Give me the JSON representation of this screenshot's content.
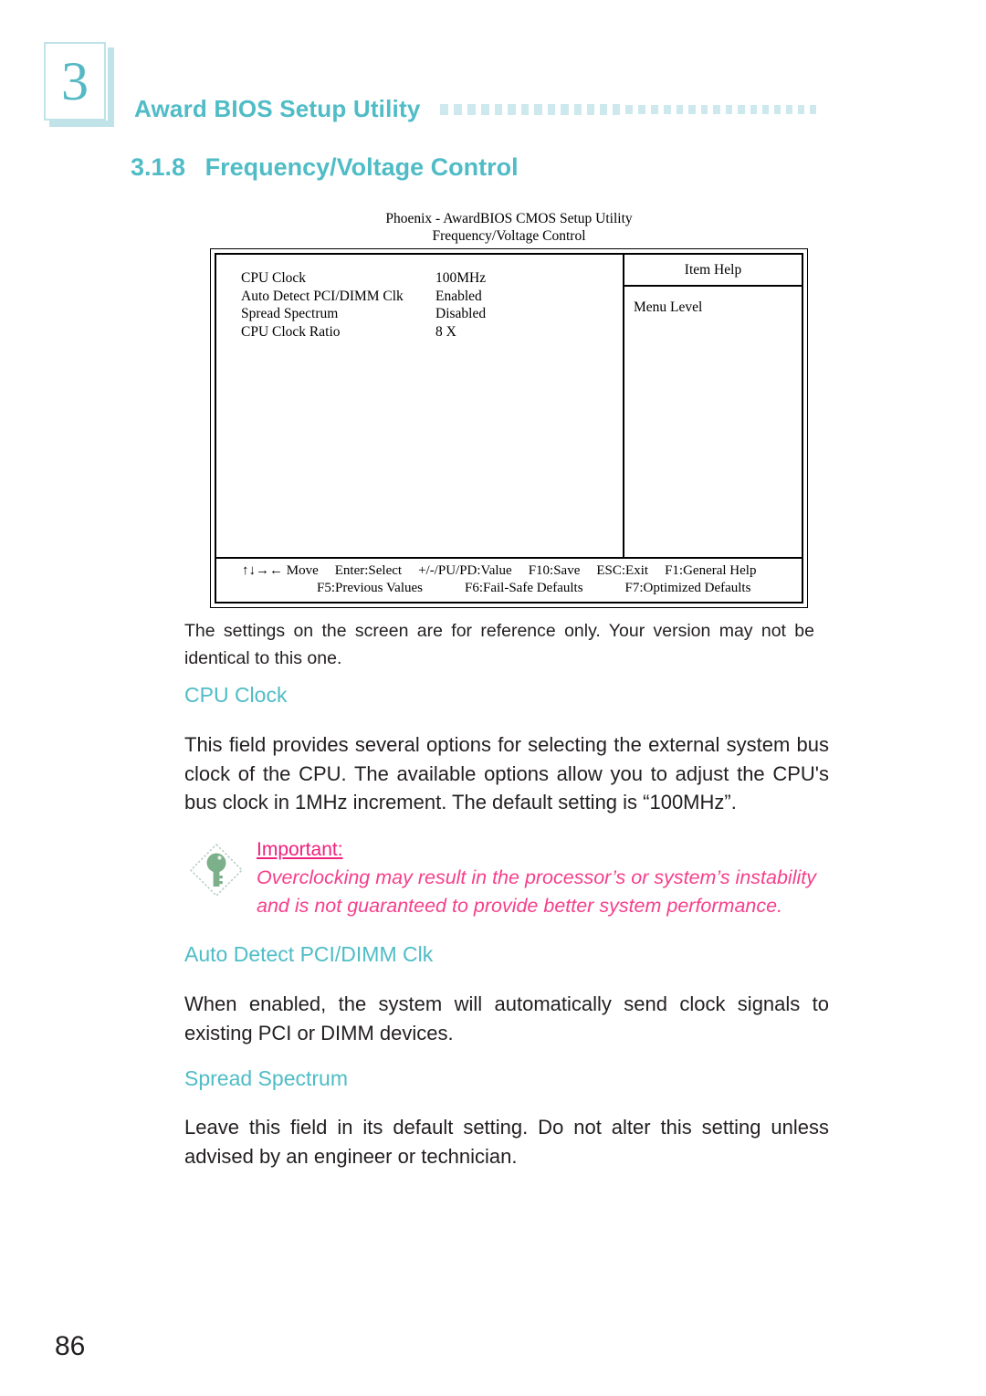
{
  "header": {
    "chapter_number": "3",
    "running_head": "Award BIOS Setup Utility",
    "dot_count": 30,
    "section_number": "3.1.8",
    "section_title": "Frequency/Voltage Control",
    "accent_color": "#4fbcc6",
    "dot_color": "#cde9ee"
  },
  "bios": {
    "title_line1": "Phoenix - AwardBIOS CMOS Setup Utility",
    "title_line2": "Frequency/Voltage  Control",
    "rows": [
      {
        "label": "CPU Clock",
        "value": "100MHz"
      },
      {
        "label": "Auto Detect PCI/DIMM Clk",
        "value": "Enabled"
      },
      {
        "label": "Spread  Spectrum",
        "value": "Disabled"
      },
      {
        "label": "CPU Clock Ratio",
        "value": "8 X"
      }
    ],
    "help_title": "Item  Help",
    "help_body": "Menu  Level",
    "footer_line1": [
      "↑↓→←  Move",
      "Enter:Select",
      "+/-/PU/PD:Value",
      "F10:Save",
      "ESC:Exit",
      "F1:General Help"
    ],
    "footer_line2": [
      "F5:Previous  Values",
      "F6:Fail-Safe Defaults",
      "F7:Optimized Defaults"
    ]
  },
  "figure_note": "The settings on the screen are for reference only. Your version may not be identical to this one.",
  "sections": {
    "cpu_clock": {
      "heading": "CPU Clock",
      "paragraph": "This field provides several options for selecting the external system bus clock of the CPU. The available options allow you to adjust the CPU's bus clock in 1MHz increment. The default setting is “100MHz”."
    },
    "auto_detect": {
      "heading": "Auto Detect PCI/DIMM Clk",
      "paragraph": "When enabled, the system will automatically send clock signals to existing PCI or DIMM devices."
    },
    "spread_spectrum": {
      "heading": "Spread Spectrum",
      "paragraph": "Leave this field in its default setting. Do not alter this setting unless advised by an engineer or technician."
    }
  },
  "important": {
    "icon": "key-diamond-icon",
    "title": "Important:",
    "line1": "Overclocking may result in the processor’s or system’s instability",
    "line2": "and is not guaranteed to provide better system performance.",
    "title_color": "#f0207c",
    "body_color": "#f5408c",
    "key_color": "#7cb08a"
  },
  "page_number": "86"
}
